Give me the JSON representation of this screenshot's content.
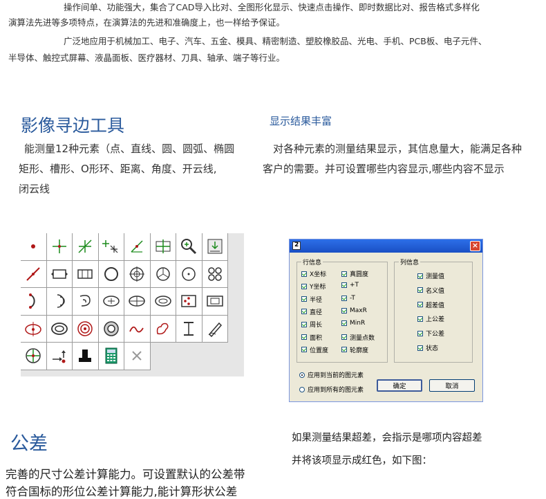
{
  "intro": {
    "line1": "操作间单、功能强大，集合了CAD导入比对、全图形化显示、快速点击操作、即时数据比对、报告格式多样化",
    "line2": "演算法先进等多项特点，在演算法的先进和准确度上，也一样给予保证。",
    "line3": "广泛地应用于机械加工、电子、汽车、五金、模具、精密制造、塑胶橡胶品、光电、手机、PCB板、电子元件、",
    "line4": "半导体、触控式屏幕、液晶面板、医疗器材、刀具、轴承、端子等行业。"
  },
  "edge": {
    "title": "影像寻边工具",
    "line1": "能测量12种元素（点、直线、圆、圆弧、椭圆",
    "line2": "矩形、槽形、O形环、距离、角度、开云线,",
    "line3": "闭云线"
  },
  "display": {
    "title": "显示结果丰富",
    "line1": "对各种元素的测量结果显示，其信息量大，能满足各种",
    "line2": "客户的需要。并可设置哪些内容显示,哪些内容不显示"
  },
  "tools": [
    "point-tool-icon",
    "cross-point-icon",
    "line-cross-icon",
    "auto-point-icon",
    "angle-line-icon",
    "center-cross-icon",
    "zoom-icon",
    "frame-icon",
    "line-tool-icon",
    "rect-icon",
    "slot-icon",
    "circle-icon",
    "crosshair-circle-icon",
    "arc-circle-icon",
    "dot-circle-icon",
    "four-circles-icon",
    "arc-icon",
    "arc-multi-icon",
    "spiral-icon",
    "ellipse-cross-icon",
    "ellipse-line-icon",
    "ring-ellipse-icon",
    "point-frame-icon",
    "double-rect-icon",
    "ellipse-point-icon",
    "ring-icon",
    "double-ring-icon",
    "o-ring-icon",
    "open-curve-icon",
    "closed-curve-icon",
    "distance-icon",
    "pen-icon",
    "target-icon",
    "arrow-point-icon",
    "hat-icon",
    "calculator-icon",
    "delete-icon"
  ],
  "dialog": {
    "title_num": "2",
    "close": "×",
    "row_group": "行信息",
    "col_group": "列信息",
    "row_left": [
      "X坐标",
      "Y坐标",
      "半径",
      "直径",
      "周长",
      "面积",
      "位置度"
    ],
    "row_right": [
      "真圆度",
      "+T",
      "-T",
      "MaxR",
      "MinR",
      "测量点数",
      "轮廓度"
    ],
    "col_items": [
      "测量值",
      "名义值",
      "超差值",
      "上公差",
      "下公差",
      "状态"
    ],
    "radio1": "应用到当前的图元素",
    "radio2": "应用到所有的图元素",
    "ok": "确定",
    "cancel": "取消"
  },
  "tolerance": {
    "title": "公差",
    "line1": "完善的尺寸公差计算能力。可设置默认的公差带",
    "line2": "符合国标的形位公差计算能力,能计算形状公差"
  },
  "overlimit": {
    "line1": "如果测量结果超差，会指示是哪项内容超差",
    "line2": "并将该项显示成红色，如下图："
  },
  "colors": {
    "heading_blue": "#2a5a9c",
    "titlebar_blue": "#1a4fc4",
    "dialog_bg": "#ece9d8"
  }
}
